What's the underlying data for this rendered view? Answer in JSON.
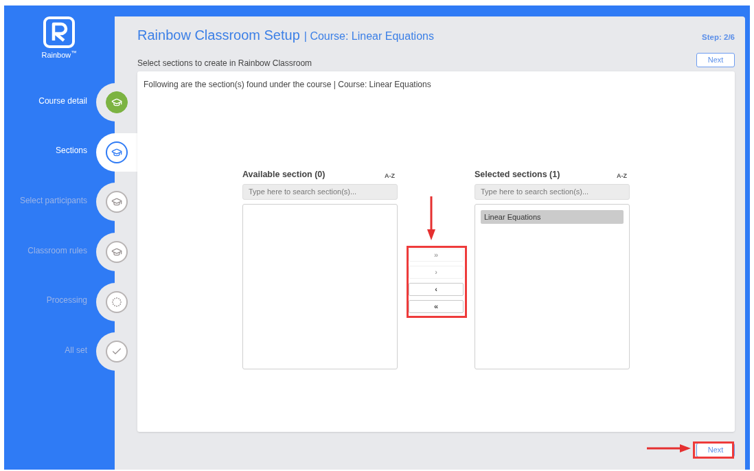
{
  "logo": {
    "wordmark": "Rainbow$^{™}$"
  },
  "steps": [
    {
      "label": "Course detail",
      "done": true,
      "selected": false,
      "kind": "course"
    },
    {
      "label": "Sections",
      "done": false,
      "selected": true,
      "kind": "sections"
    },
    {
      "label": "Select participants",
      "done": false,
      "selected": false,
      "kind": "participants"
    },
    {
      "label": "Classroom rules",
      "done": false,
      "selected": false,
      "kind": "rules"
    },
    {
      "label": "Processing",
      "done": false,
      "selected": false,
      "kind": "processing"
    },
    {
      "label": "All set",
      "done": false,
      "selected": false,
      "kind": "done"
    }
  ],
  "header": {
    "title": "Rainbow Classroom Setup",
    "subtitle": "| Course: Linear Equations",
    "step": "Step: 2/6"
  },
  "instruction": "Select sections to create in Rainbow Classroom",
  "top_next": "Next",
  "card": {
    "intro": "Following are the section(s) found under the course | Course: Linear Equations",
    "available": {
      "title": "Available section (0)",
      "sort": "A-Z",
      "placeholder": "Type here to search section(s)..."
    },
    "selected": {
      "title": "Selected sections (1)",
      "sort": "A-Z",
      "placeholder": "Type here to search section(s)...",
      "items": [
        {
          "label": "Linear Equations",
          "selected": true
        }
      ]
    },
    "transfer_buttons": [
      {
        "label": "»",
        "disabled": true
      },
      {
        "label": "›",
        "disabled": true
      },
      {
        "label": "‹",
        "disabled": false
      },
      {
        "label": "«",
        "disabled": false
      }
    ]
  },
  "bottom_next": "Next"
}
